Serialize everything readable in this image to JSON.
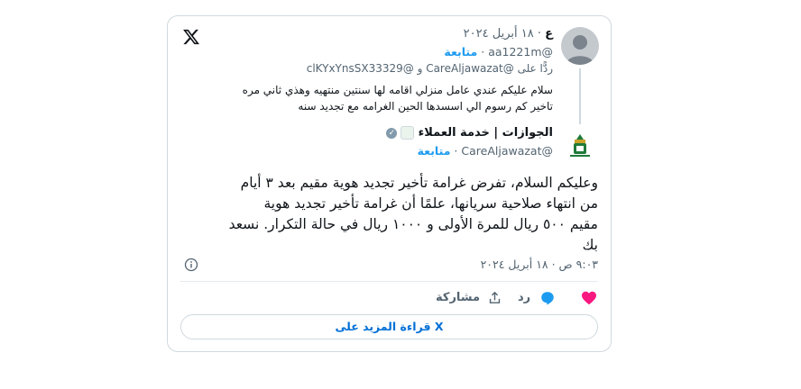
{
  "reply_tweet": {
    "author_name": "ع",
    "date": "١٨ أبريل ٢٠٢٤",
    "handle": "@aa1221m",
    "follow_label": "متابعة",
    "replying_prefix": "ردًّا على",
    "reply_to_1": "@CareAljawazat",
    "reply_conj": "و",
    "reply_to_2": "@clKYxYnsSX33329",
    "text_line1": "سلام عليكم عندي عامل منزلي اقامه لها سنتين منتهيه وهذي ثاني مره",
    "text_line2": "تاخير كم رسوم الي اسسدها الحين الغرامه مع تجديد سنه"
  },
  "main_tweet": {
    "author_name": "الجوازات | خدمة العملاء",
    "handle": "@CareAljawazat",
    "follow_label": "متابعة",
    "text_line1": "وعليكم السلام، تفرض غرامة تأخير تجديد هوية مقيم بعد ٣ أيام",
    "text_line2": "من انتهاء صلاحية سريانها، علمًا أن غرامة تأخير تجديد هوية",
    "text_line3": "مقيم ٥٠٠ ريال للمرة الأولى و ١٠٠٠ ريال في حالة التكرار. نسعد",
    "text_line4": "بك",
    "timestamp": "٩:٠٣ ص · ١٨ أبريل ٢٠٢٤"
  },
  "actions": {
    "reply_label": "رد",
    "share_label": "مشاركة"
  },
  "more_button": "قراءة المزيد على X",
  "colors": {
    "accent": "#1d9bf0",
    "like": "#f91880",
    "link": "#006fd6",
    "border": "#cfd9de"
  },
  "icons": {
    "brand": "x-logo-icon",
    "info": "info-icon",
    "like": "heart-icon",
    "reply": "reply-bubble-icon",
    "share": "share-icon",
    "verified": "verified-badge-icon"
  }
}
